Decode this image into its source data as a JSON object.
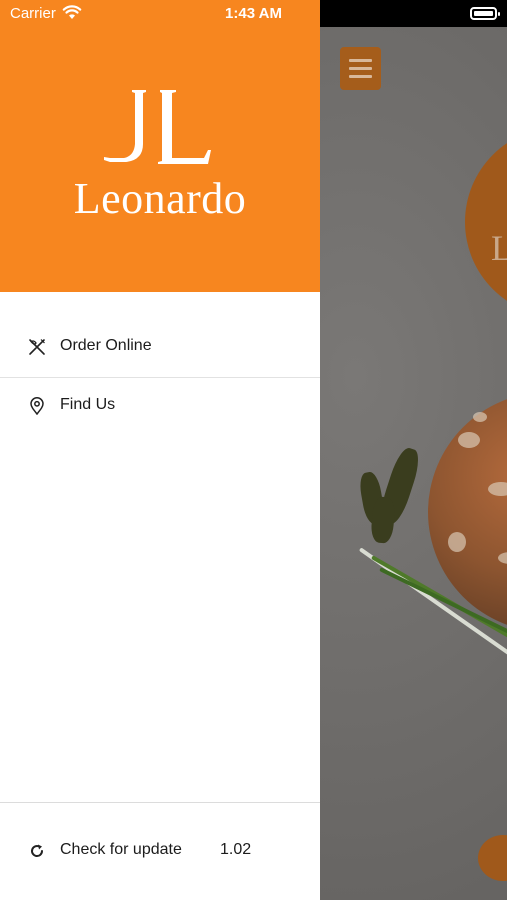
{
  "status_bar": {
    "carrier": "Carrier",
    "time": "1:43 AM",
    "wifi_icon": "wifi-icon",
    "battery_icon": "battery-icon"
  },
  "drawer": {
    "brand": {
      "monogram": "JL",
      "name": "Leonardo",
      "color": "#f7861f"
    },
    "menu": [
      {
        "label": "Order Online",
        "icon": "cutlery-icon"
      },
      {
        "label": "Find Us",
        "icon": "location-pin-icon"
      }
    ],
    "footer": {
      "label": "Check for update",
      "icon": "refresh-icon",
      "version": "1.02"
    }
  },
  "background": {
    "menu_icon": "hamburger-menu-icon",
    "logo_partial_text": "L",
    "accent_color": "#a0591b"
  }
}
